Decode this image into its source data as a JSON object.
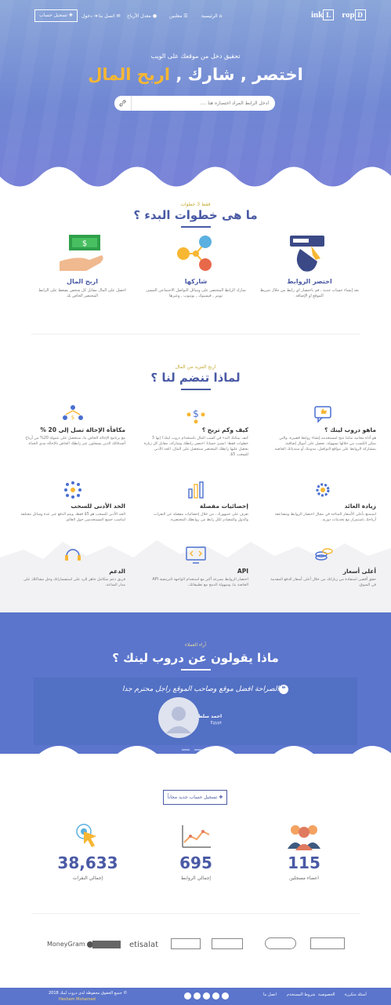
{
  "nav": {
    "home": "الرئيسية",
    "advertisers": "معلنين",
    "payouts": "معدل الأرباح",
    "contact": "اتصل بنا",
    "login": "دخول",
    "signup": "تسجيل حساب"
  },
  "logo": {
    "first": "D",
    "rest1": "rop",
    "second": "L",
    "rest2": "ink"
  },
  "hero": {
    "subtitle": "تحقيق دخل من موقعك على الويب",
    "title_main": "اختصر , شارك , ",
    "title_accent": "اربح المال",
    "search_placeholder": "ادخل الرابط المراد اختصاره هنا ...."
  },
  "steps": {
    "kicker": "فقط 3 خطوات",
    "title": "ما هى خطوات البدء ؟",
    "items": [
      {
        "title": "اختصر الروابط",
        "desc": "بعد إنشاء حساب جديد ، قم باختصار اي رابط من خلال شريط الموقع او الإضافة"
      },
      {
        "title": "شاركها",
        "desc": "شارك الرابط المختصر على وسائل التواصل الاجتماعي المسى تويتر , فيسبوك , يوتيوب , وغيرها"
      },
      {
        "title": "اربح المال",
        "desc": "احصل على المال مقابل كل شخص يضغط على الرابط المختصر الخاص بك"
      }
    ]
  },
  "why": {
    "kicker": "اربح المزيد من المال",
    "title": "لماذا تنضم لنا ؟",
    "items": [
      {
        "title": "ماهو دروب لينك ؟",
        "desc": "هو أداة مجانية تماما تتيح لمستخدمه إنشاء روابط قصيرة، والتي يمكن الكسب من خلالها بسهولة، تحصل على أموال إضافية، بمشاركة الروابط على مواقع التواصل، مدونتك أو منتدياتك الخاصة."
      },
      {
        "title": "كيف وكم تربح ؟",
        "desc": "كيف يمكنك البدء في كسب المال باستخدام دروب لينك؟ إنها 3 خطوات فقط: انشئ حسابا، اختصر رابطك وشاركه، مقابل كل زيارة يحصل عليها رابطك المختصر ستحصل على المال، الحد الأدنى للسحب 5$."
      },
      {
        "title": "مكافأة الإحالة تصل إلى 20 %",
        "desc": "مع برنامج الإحالة الخاص بنا، ستحصل على عمولة 20% من أرباح أصدقائك الذين يسجلون عبر رابطك الخاص بالإحالة مدى الحياة."
      },
      {
        "title": "زيادة العائد",
        "desc": "استمتع بأعلى الأسعار المتاحة في مجال اختصار الروابط ومضاعفة أرباحك باستمرار مع تحديثات دورية."
      },
      {
        "title": "إحصائيات مفصلة",
        "desc": "تعرف على جمهورك ، من خلال إحصائيات مفصلة عن النقرات والدول والمصادر لكل رابط من روابطك المختصرة."
      },
      {
        "title": "الحد الأدنى للسحب",
        "desc": "الحد الأدنى للسحب هو 5$ فقط، ويتم الدفع عبر عدة وسائل مختلفة لتناسب جميع المستخدمين حول العالم."
      },
      {
        "title": "أعلى أسعار",
        "desc": "حقق أقصى استفادة من زياراتك من خلال أعلى أسعار الدفع المقدمة في السوق."
      },
      {
        "title": "API",
        "desc": "اختصار الروابط بسرعة أكبر مع استخدام الواجهة البرمجية API الخاصة بنا، وسهولة الدمج مع تطبيقاتك."
      },
      {
        "title": "الدعم",
        "desc": "فريق دعم متكامل جاهز للرد على استفساراتك وحل مشاكلك على مدار الساعة."
      }
    ]
  },
  "testimonials": {
    "kicker": "آراء العملاء",
    "title": "ماذا يقولون عن دروب لينك ؟",
    "quote": "الصراحة افضل موقع وصاحب الموقع راجل محترم جدا",
    "name": "احمد سلطان",
    "country": "Egypt"
  },
  "cta": "تسجيل حساب جديد مجاناً",
  "stats": [
    {
      "value": "115",
      "label": "اعضاء مسجلين"
    },
    {
      "value": "695",
      "label": "إجمالي الروابط"
    },
    {
      "value": "38,633",
      "label": "إجمالي النقرات"
    }
  ],
  "partners": [
    "MoneyGram",
    "",
    "etisalat",
    "",
    "",
    "",
    ""
  ],
  "footer": {
    "links": [
      "اتصل بنا",
      "شروط المستخدم",
      "الخصوصية",
      "أسئلة متكررة"
    ],
    "copyright": "© جميع الحقوق محفوظة لدى دروب لينك 2018",
    "credit": "Hesham Mohamed"
  },
  "colors": {
    "primary": "#4a5aa5",
    "accent": "#f7b733",
    "band": "#5b75cc"
  }
}
